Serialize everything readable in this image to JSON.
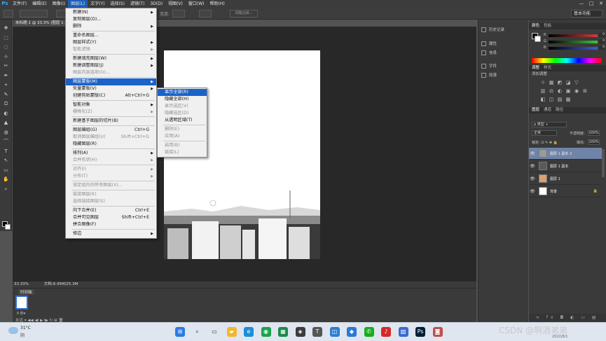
{
  "menubar": {
    "logo": "Ps",
    "items": [
      "文件(F)",
      "编辑(E)",
      "图像(I)",
      "图层(L)",
      "文字(Y)",
      "选择(S)",
      "滤镜(T)",
      "3D(D)",
      "视图(V)",
      "窗口(W)",
      "帮助(H)"
    ],
    "active_index": 3,
    "window_controls": [
      "—",
      "□",
      "✕"
    ]
  },
  "optionsbar": {
    "width_label": "宽度:",
    "edge_button": "调整边缘...",
    "workspace": "基本功能"
  },
  "document": {
    "tab_title": "未标题-1 @ 33.3% (图层 1 副本 2, RGB/8) *",
    "zoom": "33.33%",
    "doc_info": "文档:8.45M/25.3M"
  },
  "timeline": {
    "tab": "时间轴",
    "frame_time": "0 秒▾",
    "controls": "永远 ▾  ◀◀  ◀I  ▶  I▶  ↻  ⊞  🗑"
  },
  "history_panel": {
    "items": [
      "历史记录",
      "属性",
      "信息",
      "字符",
      "段落"
    ]
  },
  "color_panel": {
    "tabs": [
      "颜色",
      "色板"
    ],
    "channels": [
      {
        "label": "R",
        "value": "0",
        "color": "#d23c3c"
      },
      {
        "label": "G",
        "value": "0",
        "color": "#3ec43e"
      },
      {
        "label": "B",
        "value": "0",
        "color": "#3a5fd9"
      }
    ]
  },
  "adjust_panel": {
    "tabs": [
      "调整",
      "样式"
    ],
    "title": "添加调整",
    "icons_row1": [
      "☼",
      "▦",
      "◩",
      "◪",
      "▽"
    ],
    "icons_row2": [
      "▥",
      "⚖",
      "◐",
      "▣",
      "◉",
      "⊞"
    ],
    "icons_row3": [
      "◧",
      "◫",
      "▨",
      "▩"
    ]
  },
  "layers_panel": {
    "tabs": [
      "图层",
      "通道",
      "路径"
    ],
    "filter": "ρ 类型 ÷",
    "blend_mode": "正常",
    "opacity_label": "不透明度:",
    "opacity": "100%",
    "lock_label": "锁定: ⊡ ✎ ✥ 🔒",
    "fill_label": "填充:",
    "fill": "100%",
    "layers": [
      {
        "name": "图层 1 副本 2",
        "thumb": "#9a9a9a",
        "selected": true,
        "lock": ""
      },
      {
        "name": "图层 1 副本",
        "thumb": "#5a5a5a",
        "selected": false,
        "lock": ""
      },
      {
        "name": "图层 1",
        "thumb": "#d9a070",
        "selected": false,
        "lock": ""
      },
      {
        "name": "背景",
        "thumb": "#ffffff",
        "selected": false,
        "lock": "🔒"
      }
    ],
    "footer": "∞ fx ◘ ◐ ▭ ▤ 🗑"
  },
  "layer_menu": {
    "groups": [
      [
        {
          "label": "新建(N)",
          "arrow": true
        },
        {
          "label": "复制图层(D)..."
        },
        {
          "label": "删除",
          "arrow": true
        }
      ],
      [
        {
          "label": "重命名图层..."
        },
        {
          "label": "图层样式(Y)",
          "arrow": true
        },
        {
          "label": "智能滤镜",
          "arrow": true,
          "disabled": true
        }
      ],
      [
        {
          "label": "新建填充图层(W)",
          "arrow": true
        },
        {
          "label": "新建调整图层(J)",
          "arrow": true
        },
        {
          "label": "图层内容选项(O)...",
          "disabled": true
        }
      ],
      [
        {
          "label": "图层蒙版(M)",
          "arrow": true,
          "highlight": true
        },
        {
          "label": "矢量蒙版(V)",
          "arrow": true
        },
        {
          "label": "创建剪贴蒙版(C)",
          "shortcut": "Alt+Ctrl+G"
        }
      ],
      [
        {
          "label": "智能对象",
          "arrow": true
        },
        {
          "label": "栅格化(Z)",
          "arrow": true,
          "disabled": true
        }
      ],
      [
        {
          "label": "新建基于图层的切片(B)"
        }
      ],
      [
        {
          "label": "图层编组(G)",
          "shortcut": "Ctrl+G"
        },
        {
          "label": "取消图层编组(U)",
          "shortcut": "Shift+Ctrl+G",
          "disabled": true
        },
        {
          "label": "隐藏图层(R)"
        }
      ],
      [
        {
          "label": "排列(A)",
          "arrow": true
        },
        {
          "label": "合并形状(H)",
          "arrow": true,
          "disabled": true
        }
      ],
      [
        {
          "label": "对齐(I)",
          "arrow": true,
          "disabled": true
        },
        {
          "label": "分布(T)",
          "arrow": true,
          "disabled": true
        }
      ],
      [
        {
          "label": "锁定组内的所有图层(X)...",
          "disabled": true
        }
      ],
      [
        {
          "label": "链接图层(K)",
          "disabled": true
        },
        {
          "label": "选择链接图层(S)",
          "disabled": true
        }
      ],
      [
        {
          "label": "向下合并(E)",
          "shortcut": "Ctrl+E"
        },
        {
          "label": "合并可见图层",
          "shortcut": "Shift+Ctrl+E"
        },
        {
          "label": "拼合图像(F)"
        }
      ],
      [
        {
          "label": "修边",
          "arrow": true
        }
      ]
    ]
  },
  "mask_menu": {
    "groups": [
      [
        {
          "label": "显示全部(R)",
          "highlight": true
        },
        {
          "label": "隐藏全部(H)"
        },
        {
          "label": "显示选区(V)",
          "disabled": true
        },
        {
          "label": "隐藏选区(D)",
          "disabled": true
        },
        {
          "label": "从透明区域(T)"
        }
      ],
      [
        {
          "label": "删除(E)",
          "disabled": true
        },
        {
          "label": "应用(A)",
          "disabled": true
        }
      ],
      [
        {
          "label": "启用(B)",
          "disabled": true
        },
        {
          "label": "链接(L)",
          "disabled": true
        }
      ]
    ]
  },
  "taskbar": {
    "weather_temp": "31°C",
    "weather_desc": "阴",
    "tray_text": "CSDN @啊酒弟弟",
    "date": "2022/8/1",
    "icons": [
      {
        "name": "start-icon",
        "glyph": "⊞",
        "color": "#2b7be4"
      },
      {
        "name": "search-icon",
        "glyph": "⌕",
        "color": "#444"
      },
      {
        "name": "taskview-icon",
        "glyph": "▭",
        "color": "#444"
      },
      {
        "name": "folder-icon",
        "glyph": "▰",
        "color": "#f2b72f"
      },
      {
        "name": "edge-icon",
        "glyph": "e",
        "color": "#1b8fd6"
      },
      {
        "name": "chrome-icon",
        "glyph": "◉",
        "color": "#1aa34a"
      },
      {
        "name": "excel-icon",
        "glyph": "▦",
        "color": "#1d8a4a"
      },
      {
        "name": "app-icon",
        "glyph": "◈",
        "color": "#3b3b3b"
      },
      {
        "name": "typora-icon",
        "glyph": "T",
        "color": "#555"
      },
      {
        "name": "app-icon-2",
        "glyph": "◫",
        "color": "#2a7fd1"
      },
      {
        "name": "app-icon-3",
        "glyph": "◆",
        "color": "#2b78d8"
      },
      {
        "name": "wechat-icon",
        "glyph": "✆",
        "color": "#1aad19"
      },
      {
        "name": "netease-icon",
        "glyph": "♪",
        "color": "#d82828"
      },
      {
        "name": "app-icon-4",
        "glyph": "▧",
        "color": "#3a6bd0"
      },
      {
        "name": "photoshop-icon",
        "glyph": "Ps",
        "color": "#001e36"
      },
      {
        "name": "app-icon-5",
        "glyph": "◙",
        "color": "#c14f4f"
      }
    ]
  }
}
